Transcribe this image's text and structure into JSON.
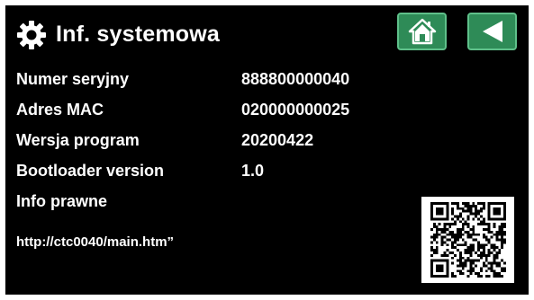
{
  "header": {
    "icon": "gear-icon",
    "title": "Inf. systemowa",
    "buttons": [
      {
        "name": "home-button",
        "icon": "home-icon"
      },
      {
        "name": "back-button",
        "icon": "back-arrow-icon"
      }
    ]
  },
  "info": [
    {
      "label": "Numer seryjny",
      "value": "888800000040"
    },
    {
      "label": "Adres MAC",
      "value": "020000000025"
    },
    {
      "label": "Wersja program",
      "value": "20200422"
    },
    {
      "label": "Bootloader version",
      "value": "1.0"
    },
    {
      "label": "Info prawne",
      "value": ""
    }
  ],
  "legal_url": "http://ctc0040/main.htm”",
  "qr_icon": "qr-code-icon",
  "colors": {
    "background": "#000000",
    "text": "#ffffff",
    "button_fill": "#2e8b57",
    "button_border": "#5fc08a"
  }
}
